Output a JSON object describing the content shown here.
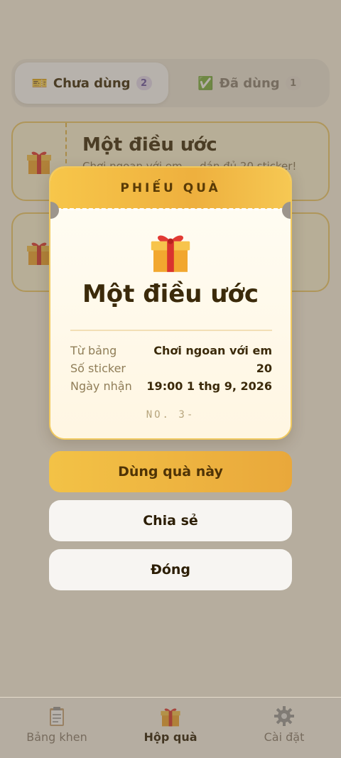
{
  "tabs": {
    "unused": {
      "icon": "🎫",
      "label": "Chưa dùng",
      "count": "2"
    },
    "used": {
      "icon": "✅",
      "label": "Đã dùng",
      "count": "1"
    }
  },
  "cards": [
    {
      "title": "Một điều ước",
      "subtitle": "Chơi ngoan với em — dán đủ 20 sticker!"
    },
    {
      "title": "",
      "subtitle": ""
    }
  ],
  "modal": {
    "header": "PHIẾU QUÀ",
    "title": "Một điều ước",
    "rows": [
      {
        "label": "Từ bảng",
        "value": "Chơi ngoan với em"
      },
      {
        "label": "Số sticker",
        "value": "20"
      },
      {
        "label": "Ngày nhận",
        "value": "19:00 1 thg 9, 2026"
      }
    ],
    "ticket_no": "NO. 3-"
  },
  "buttons": {
    "use": "Dùng quà này",
    "share": "Chia sẻ",
    "close": "Đóng"
  },
  "nav": [
    {
      "label": "Bảng khen",
      "icon": "clipboard-icon"
    },
    {
      "label": "Hộp quà",
      "icon": "gift-icon"
    },
    {
      "label": "Cài đặt",
      "icon": "gear-icon"
    }
  ],
  "colors": {
    "accent": "#f0b43f",
    "text": "#3b2a0a",
    "background": "#fdf6e6"
  }
}
